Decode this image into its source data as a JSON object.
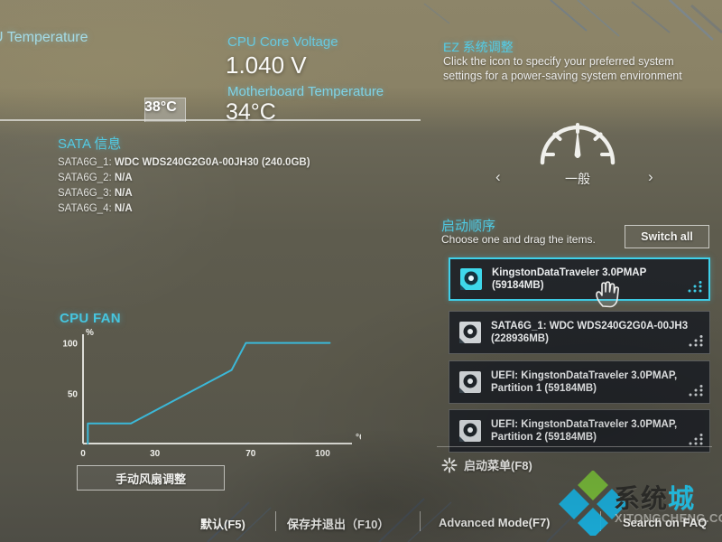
{
  "readouts": {
    "cpu_temp_label": "U Temperature",
    "cpu_temp_value": "38°C",
    "cpu_voltage_label": "CPU Core Voltage",
    "cpu_voltage_value": "1.040 V",
    "mb_temp_label": "Motherboard Temperature",
    "mb_temp_value": "34°C"
  },
  "sata": {
    "title": "SATA 信息",
    "rows": [
      {
        "key": "SATA6G_1:",
        "value": "WDC WDS240G2G0A-00JH30 (240.0GB)"
      },
      {
        "key": "SATA6G_2:",
        "value": "N/A"
      },
      {
        "key": "SATA6G_3:",
        "value": "N/A"
      },
      {
        "key": "SATA6G_4:",
        "value": "N/A"
      }
    ]
  },
  "fan": {
    "title": "CPU FAN",
    "manual_button": "手动风扇调整"
  },
  "chart_data": {
    "type": "line",
    "title": "CPU FAN",
    "xlabel": "°C",
    "ylabel": "%",
    "xlim": [
      0,
      110
    ],
    "ylim": [
      0,
      105
    ],
    "xticks": [
      0,
      30,
      70,
      100
    ],
    "xticklabels": [
      "0",
      "30",
      "70",
      "100"
    ],
    "yticks": [
      50,
      100
    ],
    "yticklabels": [
      "50",
      "100"
    ],
    "grid": false,
    "legend": false,
    "series": [
      {
        "name": "CPU FAN curve",
        "x": [
          2,
          2,
          20,
          62,
          68,
          103
        ],
        "y": [
          0,
          20,
          20,
          73,
          100,
          100
        ]
      }
    ]
  },
  "ez_tuning": {
    "title": "EZ 系统调整",
    "description": "Click the icon to specify your preferred system settings for a power-saving system environment",
    "mode": "一般",
    "prev_arrow": "‹",
    "next_arrow": "›",
    "gauge_icon": "gauge-icon"
  },
  "boot": {
    "title": "启动顺序",
    "subtitle": "Choose one and drag the items.",
    "switch_all": "Switch all",
    "items": [
      {
        "line1": "KingstonDataTraveler 3.0PMAP",
        "line2": "(59184MB)",
        "selected": true
      },
      {
        "line1": "SATA6G_1: WDC WDS240G2G0A-00JH3",
        "line2": "(228936MB)",
        "selected": false
      },
      {
        "line1": "UEFI: KingstonDataTraveler 3.0PMAP,",
        "line2": "Partition 1 (59184MB)",
        "selected": false
      },
      {
        "line1": "UEFI: KingstonDataTraveler 3.0PMAP,",
        "line2": "Partition 2 (59184MB)",
        "selected": false
      }
    ],
    "boot_menu": "启动菜单(F8)"
  },
  "bottom_bar": {
    "default": "默认(F5)",
    "save_exit": "保存并退出（F10）",
    "advanced_mode": "Advanced Mode(F7)",
    "search_faq": "Search on FAQ"
  },
  "watermark": {
    "brand": "系统城",
    "brand_plain": "系统",
    "brand_highlight": "城",
    "url": "XITONGCHENG.COM"
  },
  "colors": {
    "accent_cyan": "#4fc9e2",
    "curve_cyan": "#3bb8d8",
    "selected_border": "#3fd0ea",
    "panel_dark": "#23262a",
    "watermark_green": "#7cc23a",
    "watermark_cyan": "#24c3e8"
  }
}
